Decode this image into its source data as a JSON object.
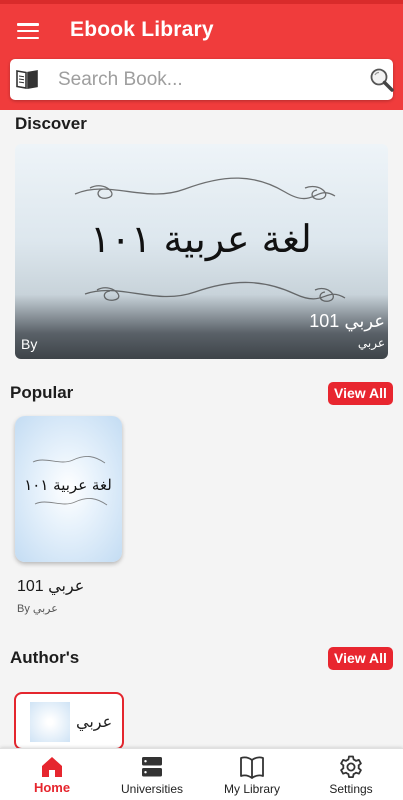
{
  "header": {
    "title": "Ebook Library",
    "menu_icon": "hamburger-menu-icon",
    "background_color": "#f03c3c"
  },
  "search": {
    "placeholder": "Search Book...",
    "value": "",
    "leading_icon": "open-book-icon",
    "trailing_icon": "magnifier-icon"
  },
  "discover": {
    "title": "Discover",
    "featured": {
      "by_label": "By",
      "book_title": "عربي 101",
      "author": "عربي",
      "cover_text": "لغة عربية ١٠١"
    }
  },
  "popular": {
    "title": "Popular",
    "view_all": "View All",
    "books": [
      {
        "title": "عربي 101",
        "author": "By عربي",
        "cover_text": "لغة عربية ١٠١"
      }
    ]
  },
  "authors": {
    "title": "Author's",
    "view_all": "View All",
    "items": [
      {
        "name": "عربي"
      }
    ]
  },
  "bottom_nav": {
    "items": [
      {
        "label": "Home",
        "icon": "home-icon",
        "active": true
      },
      {
        "label": "Universities",
        "icon": "server-icon",
        "active": false
      },
      {
        "label": "My Library",
        "icon": "book-icon",
        "active": false
      },
      {
        "label": "Settings",
        "icon": "gear-icon",
        "active": false
      }
    ]
  },
  "colors": {
    "accent": "#e8262f",
    "background": "#f4f4f4"
  }
}
